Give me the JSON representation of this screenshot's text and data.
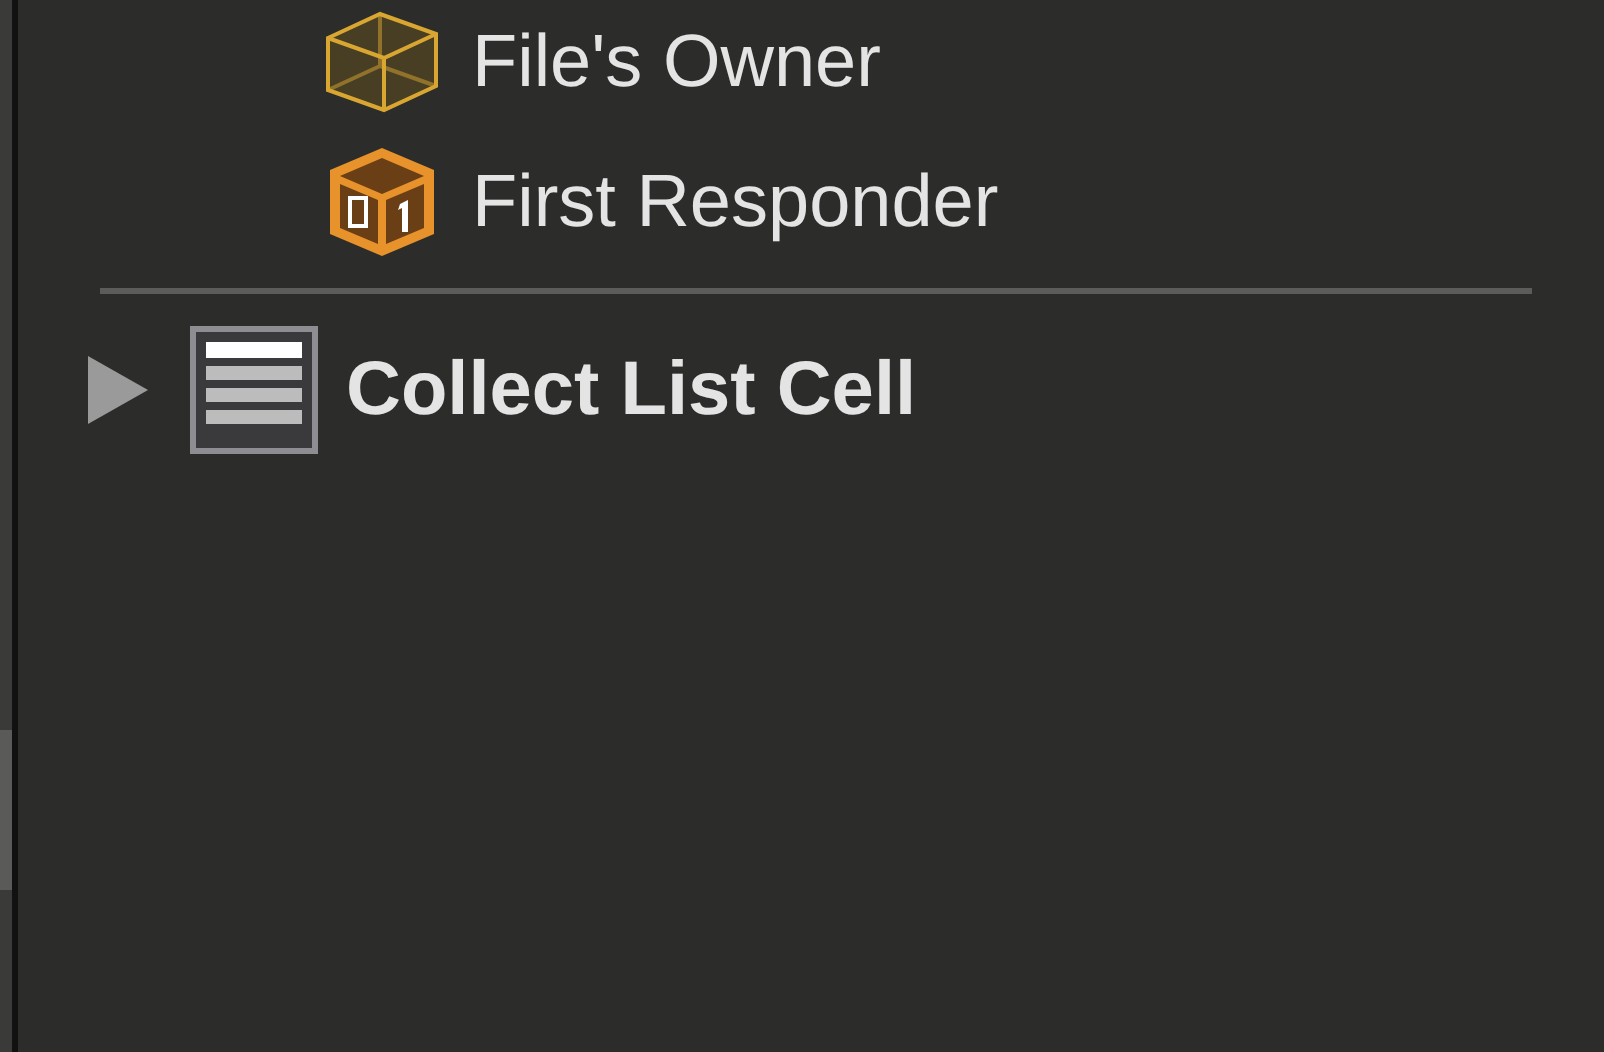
{
  "placeholders": [
    {
      "label": "File's Owner",
      "kind": "owner"
    },
    {
      "label": "First Responder",
      "kind": "responder"
    }
  ],
  "objects": [
    {
      "label": "Collect List Cell",
      "expanded": false
    }
  ]
}
